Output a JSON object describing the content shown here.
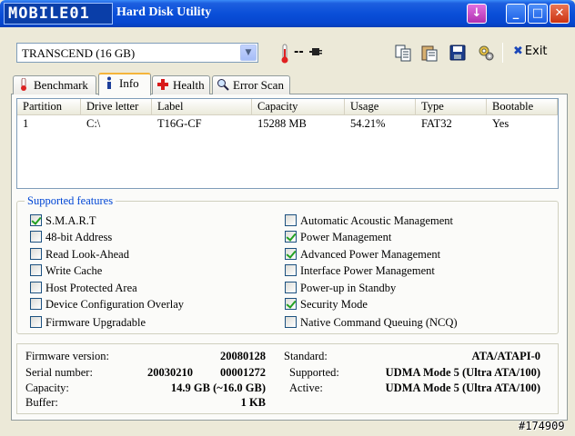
{
  "window": {
    "logo_text": "MOBILE01",
    "title": "Hard Disk Utility",
    "title_colors": {
      "bar": "#0a4fd8"
    }
  },
  "toolbar": {
    "drive": "TRANSCEND (16 GB)",
    "temperature": "--",
    "tools": [
      "copy-icon",
      "paste-icon",
      "save-icon",
      "settings-icon"
    ],
    "exit_label": "Exit"
  },
  "tabs": [
    {
      "label": "Benchmark",
      "icon": "thermometer-icon",
      "active": false
    },
    {
      "label": "Info",
      "icon": "info-icon",
      "active": true
    },
    {
      "label": "Health",
      "icon": "health-cross-icon",
      "active": false
    },
    {
      "label": "Error Scan",
      "icon": "magnifier-icon",
      "active": false
    }
  ],
  "partitions": {
    "columns": [
      "Partition",
      "Drive letter",
      "Label",
      "Capacity",
      "Usage",
      "Type",
      "Bootable"
    ],
    "rows": [
      [
        "1",
        "C:\\",
        "T16G-CF",
        "15288 MB",
        "54.21%",
        "FAT32",
        "Yes"
      ]
    ]
  },
  "features": {
    "title": "Supported features",
    "left": [
      {
        "label": "S.M.A.R.T",
        "checked": true
      },
      {
        "label": "48-bit Address",
        "checked": false
      },
      {
        "label": "Read Look-Ahead",
        "checked": false
      },
      {
        "label": "Write Cache",
        "checked": false
      },
      {
        "label": "Host Protected Area",
        "checked": false
      },
      {
        "label": "Device Configuration Overlay",
        "checked": false
      },
      {
        "label": "Firmware Upgradable",
        "checked": false
      }
    ],
    "right": [
      {
        "label": "Automatic Acoustic Management",
        "checked": false
      },
      {
        "label": "Power Management",
        "checked": true
      },
      {
        "label": "Advanced Power Management",
        "checked": true
      },
      {
        "label": "Interface Power Management",
        "checked": false
      },
      {
        "label": "Power-up in Standby",
        "checked": false
      },
      {
        "label": "Security Mode",
        "checked": true
      },
      {
        "label": "Native Command Queuing (NCQ)",
        "checked": false
      }
    ]
  },
  "details": {
    "firmware_label": "Firmware version:",
    "firmware": "20080128",
    "serial_label": "Serial number:",
    "serial_a": "20030210",
    "serial_b": "00001272",
    "capacity_label": "Capacity:",
    "capacity": "14.9 GB (~16.0 GB)",
    "buffer_label": "Buffer:",
    "buffer": "1 KB",
    "standard_label": "Standard:",
    "standard": "ATA/ATAPI-0",
    "supported_label": "Supported:",
    "supported": "UDMA Mode 5 (Ultra ATA/100)",
    "active_label": "Active:",
    "active": "UDMA Mode 5 (Ultra ATA/100)"
  },
  "watermark": "#174909"
}
